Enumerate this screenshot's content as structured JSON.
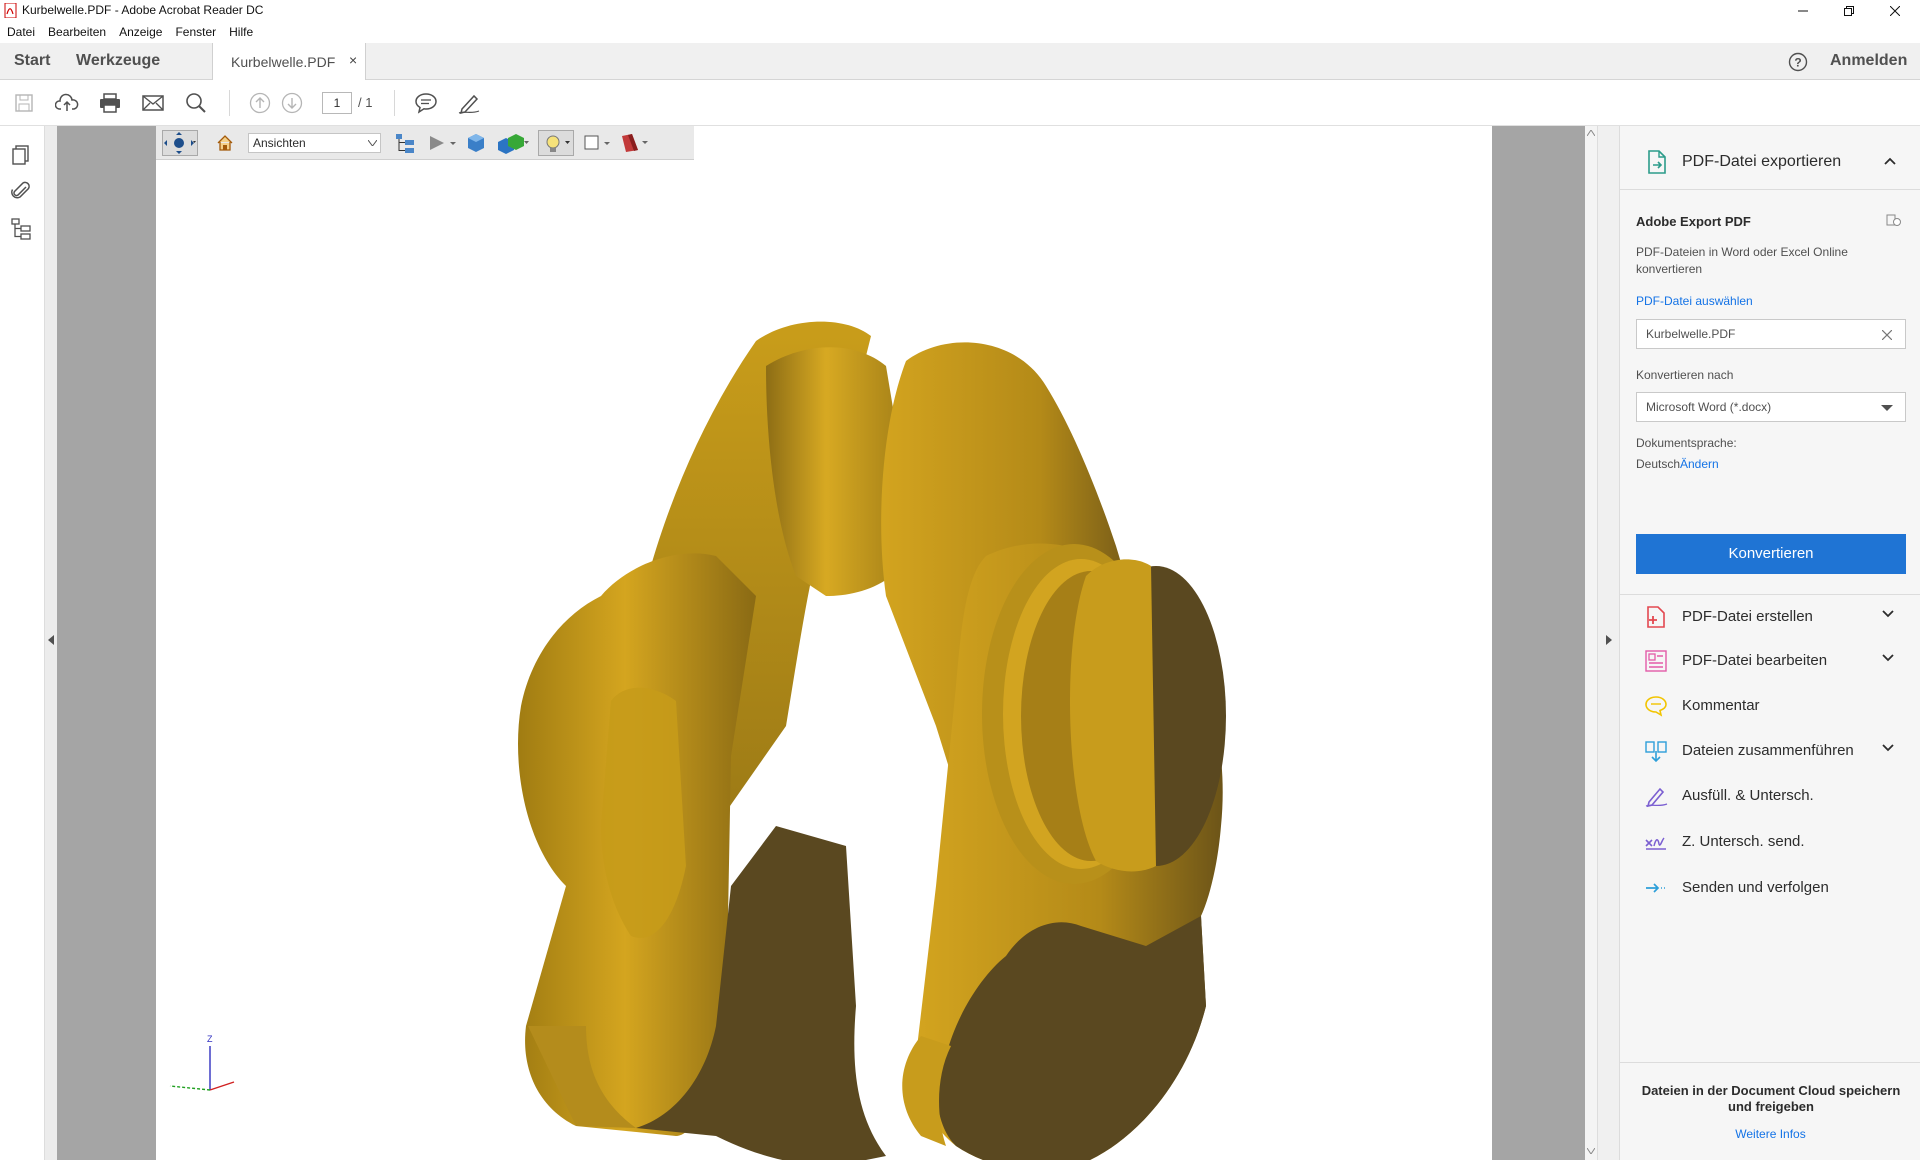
{
  "window": {
    "title": "Kurbelwelle.PDF - Adobe Acrobat Reader DC"
  },
  "menu": [
    "Datei",
    "Bearbeiten",
    "Anzeige",
    "Fenster",
    "Hilfe"
  ],
  "topnav": {
    "home": "Start",
    "tools": "Werkzeuge",
    "doc_tab": "Kurbelwelle.PDF",
    "close": "×",
    "sign_in": "Anmelden"
  },
  "toolbar": {
    "page_current": "1",
    "page_total": "/ 1"
  },
  "toolbar_3d": {
    "views_label": "Ansichten"
  },
  "axis": {
    "z_label": "Z"
  },
  "right_pane": {
    "export_title": "PDF-Datei exportieren",
    "section_title": "Adobe Export PDF",
    "description": "PDF-Dateien in Word oder Excel Online konvertieren",
    "select_file_link": "PDF-Datei auswählen",
    "file_name": "Kurbelwelle.PDF",
    "convert_to_label": "Konvertieren nach",
    "convert_to_value": "Microsoft Word (*.docx)",
    "language_label": "Dokumentsprache:",
    "language_value": "Deutsch",
    "change_link": "Ändern",
    "convert_button": "Konvertieren",
    "tools": [
      {
        "label": "PDF-Datei erstellen",
        "icon": "create-pdf-icon",
        "color": "#e34850",
        "expandable": true
      },
      {
        "label": "PDF-Datei bearbeiten",
        "icon": "edit-pdf-icon",
        "color": "#e35ba8",
        "expandable": true
      },
      {
        "label": "Kommentar",
        "icon": "comment-icon",
        "color": "#f2c400",
        "expandable": false
      },
      {
        "label": "Dateien zusammenführen",
        "icon": "combine-files-icon",
        "color": "#2d9fd9",
        "expandable": true
      },
      {
        "label": "Ausfüll. & Untersch.",
        "icon": "fill-sign-icon",
        "color": "#7b5fd1",
        "expandable": false
      },
      {
        "label": "Z. Untersch. send.",
        "icon": "send-signature-icon",
        "color": "#7b5fd1",
        "expandable": false
      },
      {
        "label": "Senden und verfolgen",
        "icon": "send-track-icon",
        "color": "#2d9fd9",
        "expandable": false
      }
    ],
    "footer_text": "Dateien in der Document Cloud speichern und freigeben",
    "footer_link": "Weitere Infos"
  },
  "colors": {
    "accent": "#1f74d4",
    "model_light": "#c89c1c",
    "model_dark": "#5a4820",
    "doc_background": "#a5a5a5"
  }
}
